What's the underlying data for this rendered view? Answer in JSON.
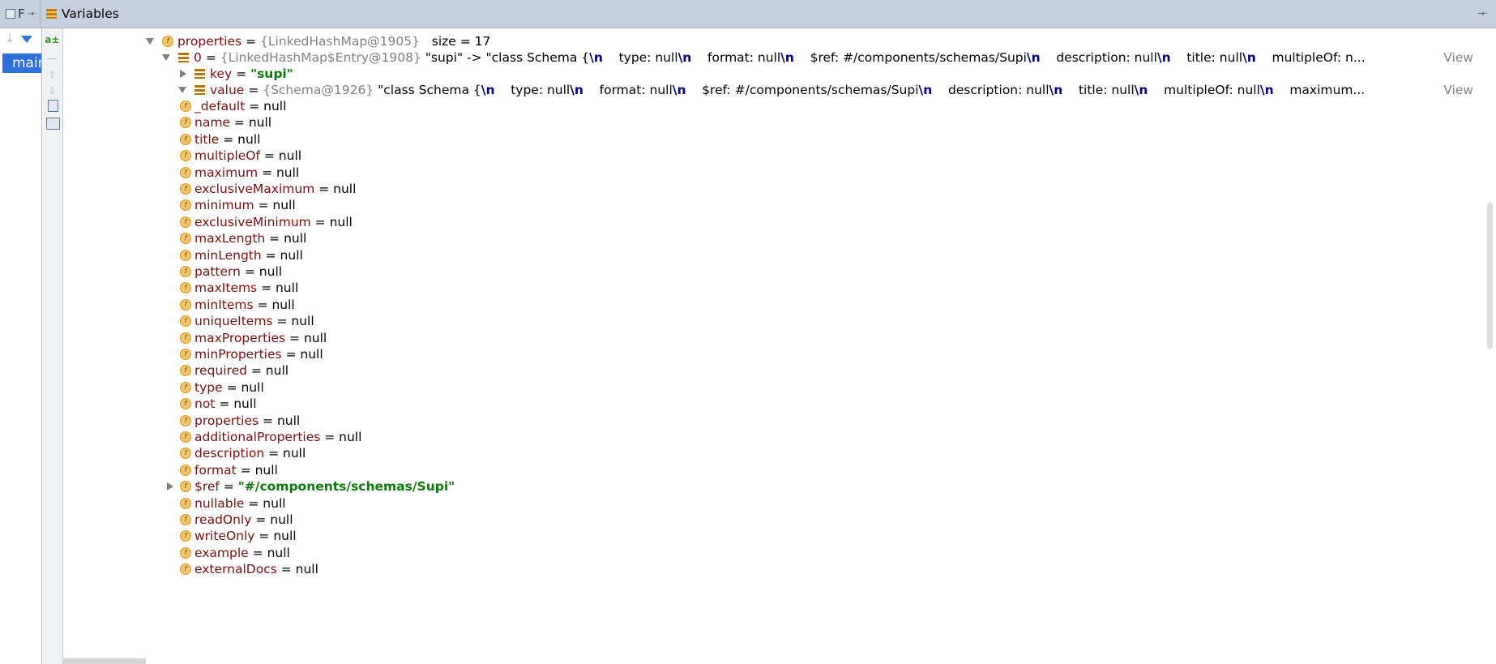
{
  "header": {
    "frames_tab_label": "F",
    "frames_pin": "→·",
    "variables_tab_label": "Variables",
    "pin_right": "→·"
  },
  "frames": {
    "thread": "main"
  },
  "tree": {
    "properties": {
      "name": "properties",
      "ref": "{LinkedHashMap@1905}",
      "size": "size = 17"
    },
    "entry": {
      "name": "0",
      "ref": "{LinkedHashMap$Entry@1908}",
      "preview_parts": [
        {
          "t": "\"supi\" -> \"class Schema {",
          "c": ""
        },
        {
          "t": "\\n",
          "c": "esc"
        },
        {
          "t": "    type: null",
          "c": ""
        },
        {
          "t": "\\n",
          "c": "esc"
        },
        {
          "t": "    format: null",
          "c": ""
        },
        {
          "t": "\\n",
          "c": "esc"
        },
        {
          "t": "    $ref: #/components/schemas/Supi",
          "c": ""
        },
        {
          "t": "\\n",
          "c": "esc"
        },
        {
          "t": "    description: null",
          "c": ""
        },
        {
          "t": "\\n",
          "c": "esc"
        },
        {
          "t": "    title: null",
          "c": ""
        },
        {
          "t": "\\n",
          "c": "esc"
        },
        {
          "t": "    multipleOf: n...",
          "c": ""
        }
      ]
    },
    "key": {
      "name": "key",
      "value": "\"supi\""
    },
    "value": {
      "name": "value",
      "ref": "{Schema@1926}",
      "preview_parts": [
        {
          "t": "\"class Schema {",
          "c": ""
        },
        {
          "t": "\\n",
          "c": "esc"
        },
        {
          "t": "    type: null",
          "c": ""
        },
        {
          "t": "\\n",
          "c": "esc"
        },
        {
          "t": "    format: null",
          "c": ""
        },
        {
          "t": "\\n",
          "c": "esc"
        },
        {
          "t": "    $ref: #/components/schemas/Supi",
          "c": ""
        },
        {
          "t": "\\n",
          "c": "esc"
        },
        {
          "t": "    description: null",
          "c": ""
        },
        {
          "t": "\\n",
          "c": "esc"
        },
        {
          "t": "    title: null",
          "c": ""
        },
        {
          "t": "\\n",
          "c": "esc"
        },
        {
          "t": "    multipleOf: null",
          "c": ""
        },
        {
          "t": "\\n",
          "c": "esc"
        },
        {
          "t": "    maximum...",
          "c": ""
        }
      ]
    },
    "view_label": "View",
    "fields": [
      {
        "name": "_default",
        "value": "null"
      },
      {
        "name": "name",
        "value": "null"
      },
      {
        "name": "title",
        "value": "null"
      },
      {
        "name": "multipleOf",
        "value": "null"
      },
      {
        "name": "maximum",
        "value": "null"
      },
      {
        "name": "exclusiveMaximum",
        "value": "null"
      },
      {
        "name": "minimum",
        "value": "null"
      },
      {
        "name": "exclusiveMinimum",
        "value": "null"
      },
      {
        "name": "maxLength",
        "value": "null"
      },
      {
        "name": "minLength",
        "value": "null"
      },
      {
        "name": "pattern",
        "value": "null"
      },
      {
        "name": "maxItems",
        "value": "null"
      },
      {
        "name": "minItems",
        "value": "null"
      },
      {
        "name": "uniqueItems",
        "value": "null"
      },
      {
        "name": "maxProperties",
        "value": "null"
      },
      {
        "name": "minProperties",
        "value": "null"
      },
      {
        "name": "required",
        "value": "null"
      },
      {
        "name": "type",
        "value": "null"
      },
      {
        "name": "not",
        "value": "null"
      },
      {
        "name": "properties",
        "value": "null"
      },
      {
        "name": "additionalProperties",
        "value": "null"
      },
      {
        "name": "description",
        "value": "null"
      },
      {
        "name": "format",
        "value": "null"
      },
      {
        "name": "$ref",
        "value": "\"#/components/schemas/Supi\"",
        "string": true,
        "expandable": true
      },
      {
        "name": "nullable",
        "value": "null"
      },
      {
        "name": "readOnly",
        "value": "null"
      },
      {
        "name": "writeOnly",
        "value": "null"
      },
      {
        "name": "example",
        "value": "null"
      },
      {
        "name": "externalDocs",
        "value": "null"
      }
    ]
  }
}
